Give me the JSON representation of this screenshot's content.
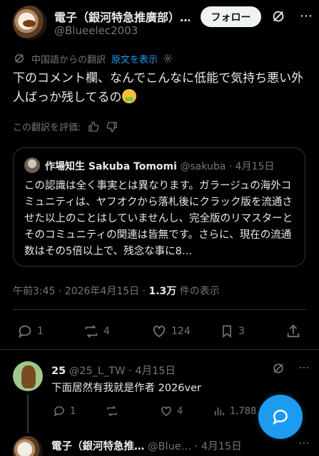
{
  "post": {
    "author_name": "電子（銀河特急推廣部）…",
    "author_handle": "@Blueelec2003",
    "follow_label": "フォロー",
    "translation_note": "中国語からの翻訳",
    "show_original": "原文を表示",
    "text": "下のコメント欄、なんでこんなに低能で気持ち悪い外人ばっか残してるの",
    "rate_label": "この翻訳を評価:",
    "time": "午前3:45 · 2026年4月15日 · ",
    "views": "1.3万",
    "views_label": " 件の表示",
    "stats": {
      "replies": "1",
      "reposts": "4",
      "likes": "124",
      "bookmarks": "3"
    }
  },
  "quote": {
    "name": "作場知生 Sakuba Tomomi",
    "handle": "@sakuba",
    "date": " · 4月15日",
    "text": "この認識は全く事実とは異なります。ガラージュの海外コミュニティは、ヤフオクから落札後にクラック版を流通させた以上のことはしていませんし、完全版のリマスターとそのコミュニティの関連は皆無です。さらに、現在の流通数はその5倍以上で、残念な事に8…"
  },
  "reply": {
    "name": "25",
    "handle": "@25_L_TW",
    "date": " · 4月15日",
    "text": "下面居然有我就是作者 2026ver",
    "stats": {
      "replies": "1",
      "likes": "4",
      "views": "1,788"
    }
  },
  "next": {
    "name": "電子（銀河特急推…",
    "handle": "@Blue…",
    "date": " · 4月15日"
  },
  "colors": {
    "accent": "#1d9bf0",
    "muted": "#71767b",
    "text": "#e7e9ea",
    "background": "#000000"
  }
}
